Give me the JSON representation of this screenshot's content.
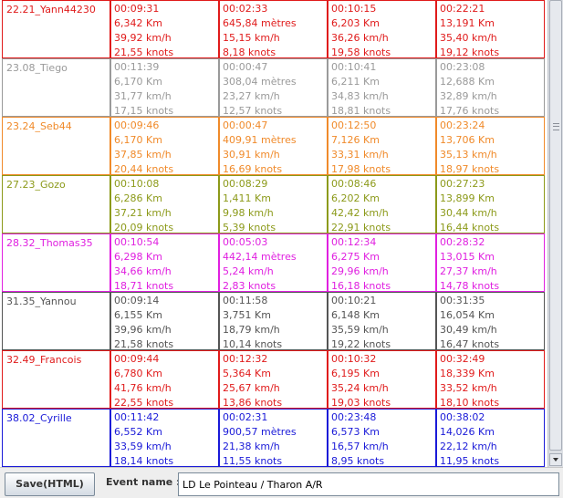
{
  "rows": [
    {
      "color": "#e01b1b",
      "name": "22.21_Yann44230",
      "cells": [
        [
          "00:09:31",
          "6,342 Km",
          "39,92 km/h",
          "21,55 knots"
        ],
        [
          "00:02:33",
          "645,84 mètres",
          "15,15 km/h",
          "8,18 knots"
        ],
        [
          "00:10:15",
          "6,203 Km",
          "36,26 km/h",
          "19,58 knots"
        ],
        [
          "00:22:21",
          "13,191 Km",
          "35,40 km/h",
          "19,12 knots"
        ]
      ]
    },
    {
      "color": "#9a9a9a",
      "name": "23.08_Tiego",
      "cells": [
        [
          "00:11:39",
          "6,170 Km",
          "31,77 km/h",
          "17,15 knots"
        ],
        [
          "00:00:47",
          "308,04 mètres",
          "23,27 km/h",
          "12,57 knots"
        ],
        [
          "00:10:41",
          "6,211 Km",
          "34,83 km/h",
          "18,81 knots"
        ],
        [
          "00:23:08",
          "12,688 Km",
          "32,89 km/h",
          "17,76 knots"
        ]
      ]
    },
    {
      "color": "#f08a2a",
      "name": "23.24_Seb44",
      "cells": [
        [
          "00:09:46",
          "6,170 Km",
          "37,85 km/h",
          "20,44 knots"
        ],
        [
          "00:00:47",
          "409,91 mètres",
          "30,91 km/h",
          "16,69 knots"
        ],
        [
          "00:12:50",
          "7,126 Km",
          "33,31 km/h",
          "17,98 knots"
        ],
        [
          "00:23:24",
          "13,706 Km",
          "35,13 km/h",
          "18,97 knots"
        ]
      ]
    },
    {
      "color": "#8c9a1a",
      "name": "27.23_Gozo",
      "cells": [
        [
          "00:10:08",
          "6,286 Km",
          "37,21 km/h",
          "20,09 knots"
        ],
        [
          "00:08:29",
          "1,411 Km",
          "9,98 km/h",
          "5,39 knots"
        ],
        [
          "00:08:46",
          "6,202 Km",
          "42,42 km/h",
          "22,91 knots"
        ],
        [
          "00:27:23",
          "13,899 Km",
          "30,44 km/h",
          "16,44 knots"
        ]
      ]
    },
    {
      "color": "#e020e0",
      "name": "28.32_Thomas35",
      "cells": [
        [
          "00:10:54",
          "6,298 Km",
          "34,66 km/h",
          "18,71 knots"
        ],
        [
          "00:05:03",
          "442,14 mètres",
          "5,24 km/h",
          "2,83 knots"
        ],
        [
          "00:12:34",
          "6,275 Km",
          "29,96 km/h",
          "16,18 knots"
        ],
        [
          "00:28:32",
          "13,015 Km",
          "27,37 km/h",
          "14,78 knots"
        ]
      ]
    },
    {
      "color": "#555555",
      "name": "31.35_Yannou",
      "cells": [
        [
          "00:09:14",
          "6,155 Km",
          "39,96 km/h",
          "21,58 knots"
        ],
        [
          "00:11:58",
          "3,751 Km",
          "18,79 km/h",
          "10,14 knots"
        ],
        [
          "00:10:21",
          "6,148 Km",
          "35,59 km/h",
          "19,22 knots"
        ],
        [
          "00:31:35",
          "16,054 Km",
          "30,49 km/h",
          "16,47 knots"
        ]
      ]
    },
    {
      "color": "#e01b1b",
      "name": "32.49_Francois",
      "cells": [
        [
          "00:09:44",
          "6,780 Km",
          "41,76 km/h",
          "22,55 knots"
        ],
        [
          "00:12:32",
          "5,364 Km",
          "25,67 km/h",
          "13,86 knots"
        ],
        [
          "00:10:32",
          "6,195 Km",
          "35,24 km/h",
          "19,03 knots"
        ],
        [
          "00:32:49",
          "18,339 Km",
          "33,52 km/h",
          "18,10 knots"
        ]
      ]
    },
    {
      "color": "#1a1ad8",
      "name": "38.02_Cyrille",
      "cells": [
        [
          "00:11:42",
          "6,552 Km",
          "33,59 km/h",
          "18,14 knots"
        ],
        [
          "00:02:31",
          "900,57 mètres",
          "21,38 km/h",
          "11,55 knots"
        ],
        [
          "00:23:48",
          "6,573 Km",
          "16,57 km/h",
          "8,95 knots"
        ],
        [
          "00:38:02",
          "14,026 Km",
          "22,12 km/h",
          "11,95 knots"
        ]
      ]
    }
  ],
  "toolbar": {
    "save_label": "Save(HTML)",
    "event_label": "Event name :",
    "event_value": "LD Le Pointeau / Tharon A/R"
  }
}
